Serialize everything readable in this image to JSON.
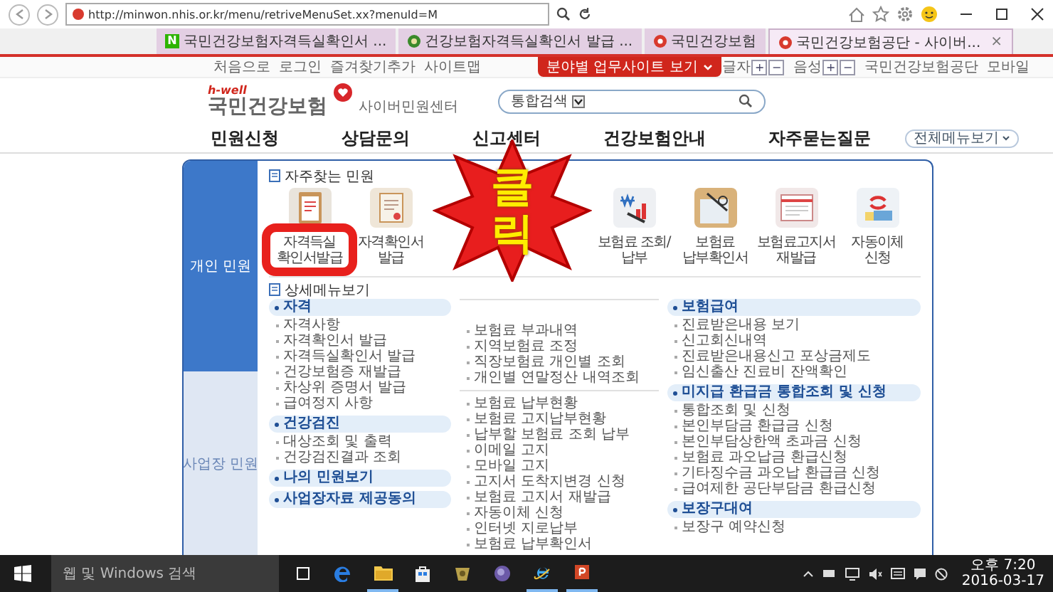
{
  "browser": {
    "address": "http://minwon.nhis.or.kr/menu/retriveMenuSet.xx?menuId=M",
    "tabs": [
      {
        "title": "국민건강보험자격득실확인서 ...",
        "kind": "letter",
        "badge": "N",
        "selected": false
      },
      {
        "title": "건강보험자격득실확인서 발급 ...",
        "kind": "globe",
        "selected": false
      },
      {
        "title": "국민건강보험",
        "kind": "site",
        "selected": false
      },
      {
        "title": "국민건강보험공단 - 사이버...",
        "kind": "site",
        "selected": true,
        "close": "×"
      }
    ]
  },
  "utility_bar": {
    "links": [
      "처음으로",
      "로그인",
      "즐겨찾기추가",
      "사이트맵"
    ],
    "site_button": "분야별 업무사이트 보기",
    "controls": [
      {
        "label": "글자",
        "plus": "+",
        "minus": "−"
      },
      {
        "label": "음성",
        "plus": "+",
        "minus": "−"
      }
    ],
    "links_right": [
      "국민건강보험공단",
      "모바일"
    ]
  },
  "header": {
    "logo_tag": "h-well",
    "logo_name": "국민건강보험",
    "center_name": "사이버민원센터",
    "search_scope": "통합검색"
  },
  "nav": {
    "items": [
      "민원신청",
      "상담문의",
      "신고센터",
      "건강보험안내",
      "자주묻는질문"
    ],
    "all_menu": "전체메뉴보기"
  },
  "sidebar": {
    "items": [
      {
        "label": "개인 민원",
        "selected": true
      },
      {
        "label": "사업장 민원",
        "selected": false
      }
    ]
  },
  "favorites": {
    "title": "자주찾는 민원",
    "tiles": [
      {
        "kind": "clipboard",
        "label": "자격득실 확인서발급"
      },
      {
        "kind": "certificate",
        "label": "자격확인서 발급"
      },
      {
        "kind": "covered"
      },
      {
        "kind": "covered"
      },
      {
        "kind": "chart",
        "label": "보험료 조회/납부"
      },
      {
        "kind": "glasses",
        "label": "보험료 납부확인서"
      },
      {
        "kind": "bill",
        "label": "보험료고지서 재발급"
      },
      {
        "kind": "refresh",
        "label": "자동이체 신청"
      }
    ]
  },
  "detail_menu": {
    "title": "상세메뉴보기",
    "columns": [
      {
        "groups": [
          {
            "title": "자격",
            "items": [
              "자격사항",
              "자격확인서 발급",
              "자격득실확인서 발급",
              "건강보험증 재발급",
              "차상위 증명서 발급",
              "급여정지 사항"
            ]
          },
          {
            "title": "건강검진",
            "items": [
              "대상조회 및 출력",
              "건강검진결과 조회"
            ]
          },
          {
            "title": "나의 민원보기"
          },
          {
            "title": "사업장자료 제공동의"
          }
        ]
      },
      {
        "groups": [
          {
            "items": [
              "보험료 부과내역",
              "지역보험료 조정",
              "직장보험료 개인별 조회",
              "개인별 연말정산 내역조회"
            ]
          },
          {
            "items": [
              "보험료 납부현황",
              "보험료 고지납부현황",
              "납부할 보험료 조회 납부",
              "이메일 고지",
              "모바일 고지",
              "고지서 도착지변경 신청",
              "보험료 고지서 재발급",
              "자동이체 신청",
              "인터넷 지로납부",
              "보험료 납부확인서"
            ]
          }
        ]
      },
      {
        "groups": [
          {
            "title": "보험급여",
            "items": [
              "진료받은내용 보기",
              "신고회신내역",
              "진료받은내용신고 포상금제도",
              "임신출산 진료비 잔액확인"
            ]
          },
          {
            "title": "미지급 환급금 통합조회 및 신청",
            "items": [
              "통합조회 및 신청",
              "본인부담금 환급금 신청",
              "본인부담상한액 초과금 신청",
              "보험료 과오납금 환급신청",
              "기타징수금 과오납 환급금 신청",
              "급여제한 공단부담금 환급신청"
            ]
          },
          {
            "title": "보장구대여",
            "items": [
              "보장구 예약신청"
            ]
          }
        ]
      }
    ]
  },
  "overlay": {
    "click_label": "클릭"
  },
  "taskbar": {
    "search_placeholder": "웹 및 Windows 검색",
    "time": "오후 7:20",
    "date": "2016-03-17",
    "apps": [
      {
        "kind": "taskview",
        "running": false
      },
      {
        "kind": "edge",
        "running": false
      },
      {
        "kind": "folder",
        "running": true
      },
      {
        "kind": "store",
        "running": false
      },
      {
        "kind": "app",
        "running": false
      },
      {
        "kind": "globe",
        "running": false
      },
      {
        "kind": "ie",
        "running": true
      },
      {
        "kind": "ppt",
        "running": true
      }
    ]
  }
}
